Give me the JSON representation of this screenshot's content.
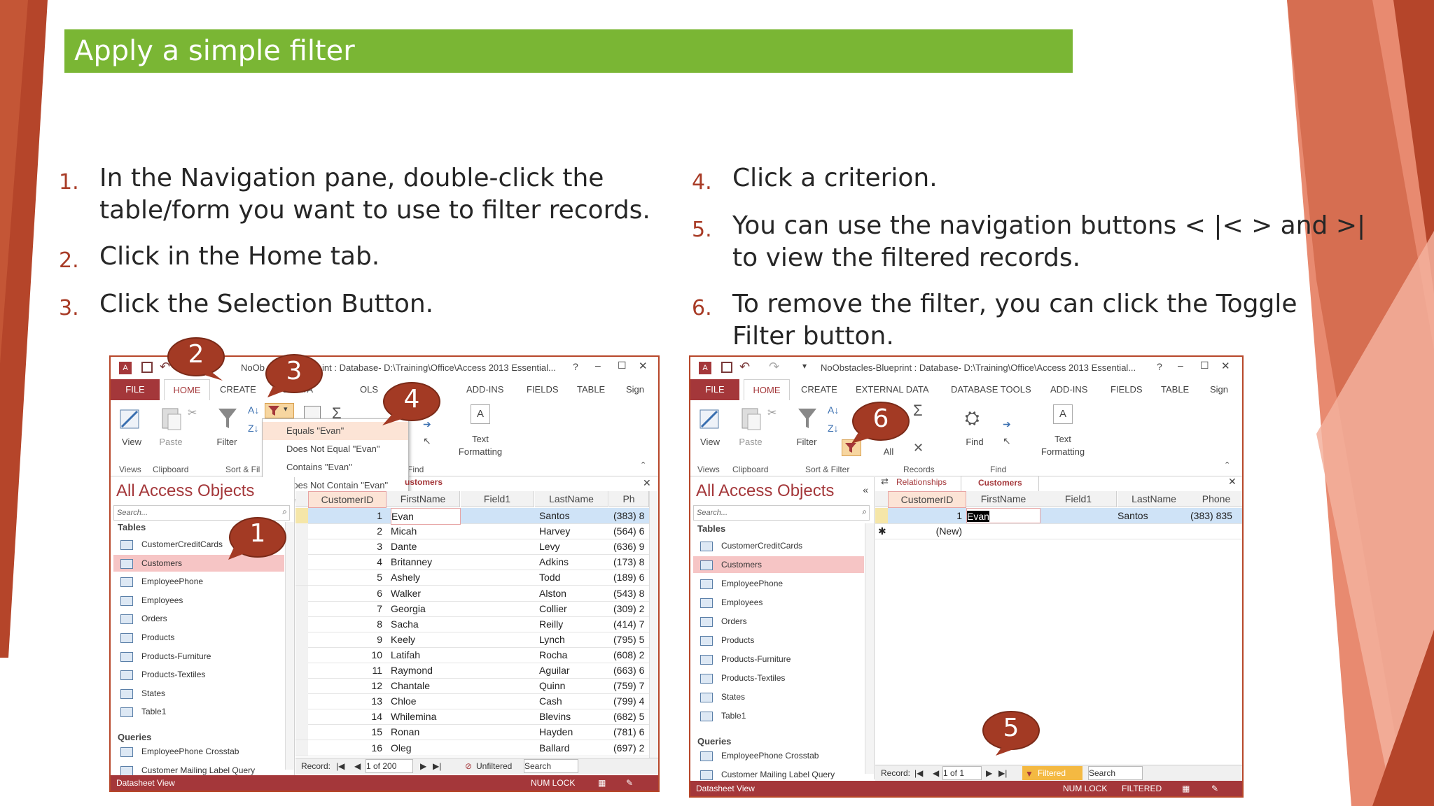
{
  "slide": {
    "title": "Apply a simple filter",
    "steps_left": [
      {
        "num": "1.",
        "lines": [
          "In the Navigation pane, double-click the",
          "table/form you want to use to filter records."
        ]
      },
      {
        "num": "2.",
        "lines": [
          "Click in the Home tab."
        ]
      },
      {
        "num": "3.",
        "lines": [
          "Click the Selection Button."
        ]
      }
    ],
    "steps_right": [
      {
        "num": "4.",
        "lines": [
          "Click a criterion."
        ]
      },
      {
        "num": "5.",
        "lines": [
          "You can use the navigation buttons < |< > and >|",
          "to view the filtered records."
        ]
      },
      {
        "num": "6.",
        "lines": [
          "To remove the filter, you can click the Toggle",
          "Filter button."
        ]
      }
    ]
  },
  "colors": {
    "accent": "#7ab634",
    "brand": "#a4373a",
    "number": "#a83b26",
    "callout": "#a33a24",
    "deco_dark": "#b5452a",
    "deco_light": "#f0a58f"
  },
  "callouts": [
    "1",
    "2",
    "3",
    "4",
    "5",
    "6"
  ],
  "left_window": {
    "title": "NoOb...int : Database- D:\\Training\\Office\\Access 2013 Essential...",
    "title_a": "NoOb",
    "title_b": "int : Database- D:\\Training\\Office\\Access 2013 Essential...",
    "tabs": [
      "FILE",
      "HOME",
      "CREATE",
      "EXTERNAL DATA",
      "DATA",
      "OLS",
      "ADD-INS",
      "FIELDS",
      "TABLE",
      "Sign"
    ],
    "tabs_visible": {
      "file": "FILE",
      "home": "HOME",
      "create": "CREATE",
      "ext": "L DATA",
      "data": "DATA",
      "ols": "OLS",
      "addins": "ADD-INS",
      "fields": "FIELDS",
      "table": "TABLE",
      "sign": "Sign"
    },
    "ribbon": {
      "view": "View",
      "paste": "Paste",
      "filter": "Filter",
      "text": "Text",
      "formatting": "Formatting",
      "groups": {
        "views": "Views",
        "clipboard": "Clipboard",
        "sortfilter": "Sort & Fil",
        "find": "Find"
      }
    },
    "dropdown": [
      "Equals \"Evan\"",
      "Does Not Equal \"Evan\"",
      "Contains \"Evan\"",
      "Does Not Contain \"Evan\""
    ],
    "nav": {
      "header": "All Access Objects",
      "search": "Search...",
      "tables_label": "Tables",
      "tables": [
        "CustomerCreditCards",
        "Customers",
        "EmployeePhone",
        "Employees",
        "Orders",
        "Products",
        "Products-Furniture",
        "Products-Textiles",
        "States",
        "Table1"
      ],
      "queries_label": "Queries",
      "queries": [
        "EmployeePhone Crosstab",
        "Customer Mailing Label Query"
      ]
    },
    "tab_label": "ustomers",
    "columns": [
      "CustomerID",
      "FirstName",
      "Field1",
      "LastName",
      "Ph"
    ],
    "rows": [
      [
        "1",
        "Evan",
        "",
        "Santos",
        "(383) 8"
      ],
      [
        "2",
        "Micah",
        "",
        "Harvey",
        "(564) 6"
      ],
      [
        "3",
        "Dante",
        "",
        "Levy",
        "(636) 9"
      ],
      [
        "4",
        "Britanney",
        "",
        "Adkins",
        "(173) 8"
      ],
      [
        "5",
        "Ashely",
        "",
        "Todd",
        "(189) 6"
      ],
      [
        "6",
        "Walker",
        "",
        "Alston",
        "(543) 8"
      ],
      [
        "7",
        "Georgia",
        "",
        "Collier",
        "(309) 2"
      ],
      [
        "8",
        "Sacha",
        "",
        "Reilly",
        "(414) 7"
      ],
      [
        "9",
        "Keely",
        "",
        "Lynch",
        "(795) 5"
      ],
      [
        "10",
        "Latifah",
        "",
        "Rocha",
        "(608) 2"
      ],
      [
        "11",
        "Raymond",
        "",
        "Aguilar",
        "(663) 6"
      ],
      [
        "12",
        "Chantale",
        "",
        "Quinn",
        "(759) 7"
      ],
      [
        "13",
        "Chloe",
        "",
        "Cash",
        "(799) 4"
      ],
      [
        "14",
        "Whilemina",
        "",
        "Blevins",
        "(682) 5"
      ],
      [
        "15",
        "Ronan",
        "",
        "Hayden",
        "(781) 6"
      ],
      [
        "16",
        "Oleg",
        "",
        "Ballard",
        "(697) 2"
      ]
    ],
    "recnav": {
      "label": "Record:",
      "pos": "1 of 200",
      "filter": "Unfiltered",
      "search": "Search"
    },
    "status": {
      "left": "Datasheet View",
      "numlock": "NUM LOCK"
    }
  },
  "right_window": {
    "title": "NoObstacles-Blueprint : Database- D:\\Training\\Office\\Access 2013 Essential...",
    "tabs": {
      "file": "FILE",
      "home": "HOME",
      "create": "CREATE",
      "ext": "EXTERNAL DATA",
      "dbtools": "DATABASE TOOLS",
      "addins": "ADD-INS",
      "fields": "FIELDS",
      "table": "TABLE",
      "sign": "Sign"
    },
    "ribbon": {
      "view": "View",
      "paste": "Paste",
      "filter": "Filter",
      "refresh": "All",
      "find": "Find",
      "text": "Text",
      "formatting": "Formatting",
      "groups": {
        "views": "Views",
        "clipboard": "Clipboard",
        "sortfilter": "Sort & Filter",
        "records": "Records",
        "find": "Find"
      }
    },
    "nav": {
      "header": "All Access Objects",
      "search": "Search...",
      "tables_label": "Tables",
      "tables": [
        "CustomerCreditCards",
        "Customers",
        "EmployeePhone",
        "Employees",
        "Orders",
        "Products",
        "Products-Furniture",
        "Products-Textiles",
        "States",
        "Table1"
      ],
      "queries_label": "Queries",
      "queries": [
        "EmployeePhone Crosstab",
        "Customer Mailing Label Query"
      ]
    },
    "doc_tabs": [
      "Relationships",
      "Customers"
    ],
    "columns": [
      "CustomerID",
      "FirstName",
      "Field1",
      "LastName",
      "Phone"
    ],
    "row": [
      "1",
      "Evan",
      "",
      "Santos",
      "(383) 835"
    ],
    "new_row": "(New)",
    "recnav": {
      "label": "Record:",
      "pos": "1 of 1",
      "filter": "Filtered",
      "search": "Search"
    },
    "status": {
      "left": "Datasheet View",
      "numlock": "NUM LOCK",
      "filtered": "FILTERED"
    }
  }
}
